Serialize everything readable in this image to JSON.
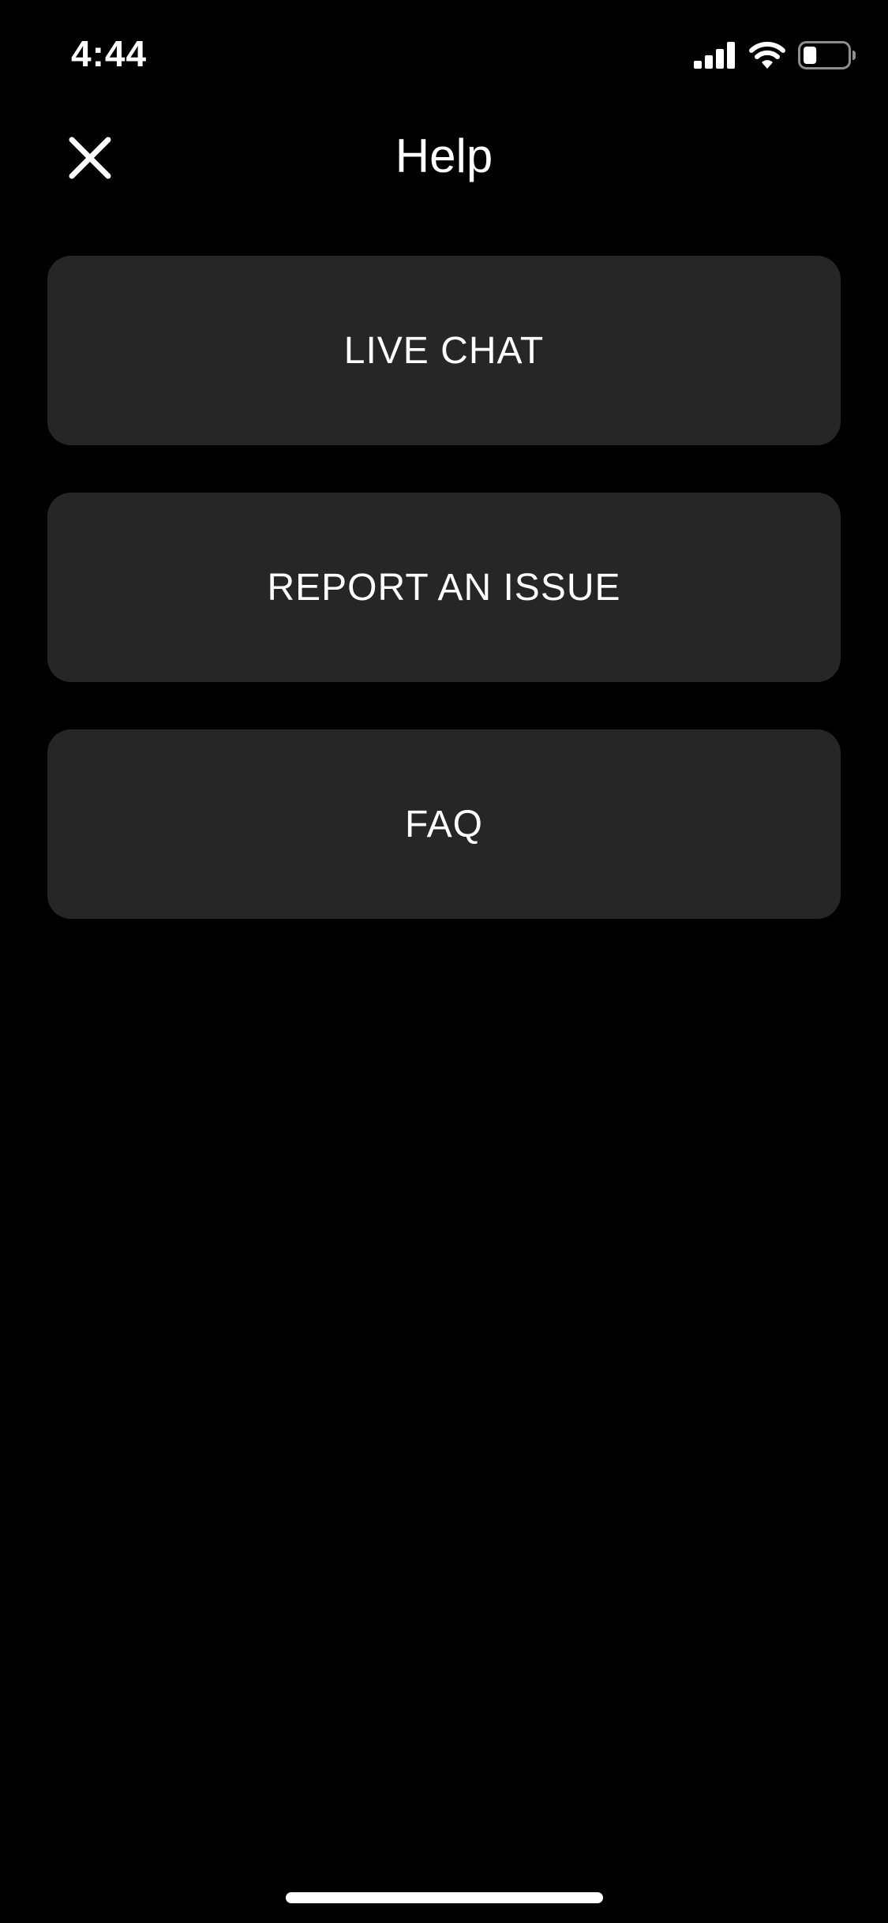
{
  "status_bar": {
    "time": "4:44",
    "icons": [
      "signal-icon",
      "wifi-icon",
      "battery-icon"
    ],
    "battery_level": 0.3
  },
  "header": {
    "title": "Help",
    "close_icon": "close-icon"
  },
  "menu": {
    "items": [
      {
        "label": "LIVE CHAT"
      },
      {
        "label": "REPORT AN ISSUE"
      },
      {
        "label": "FAQ"
      }
    ]
  },
  "colors": {
    "background": "#000000",
    "button_background": "#262626",
    "text": "#ffffff"
  }
}
